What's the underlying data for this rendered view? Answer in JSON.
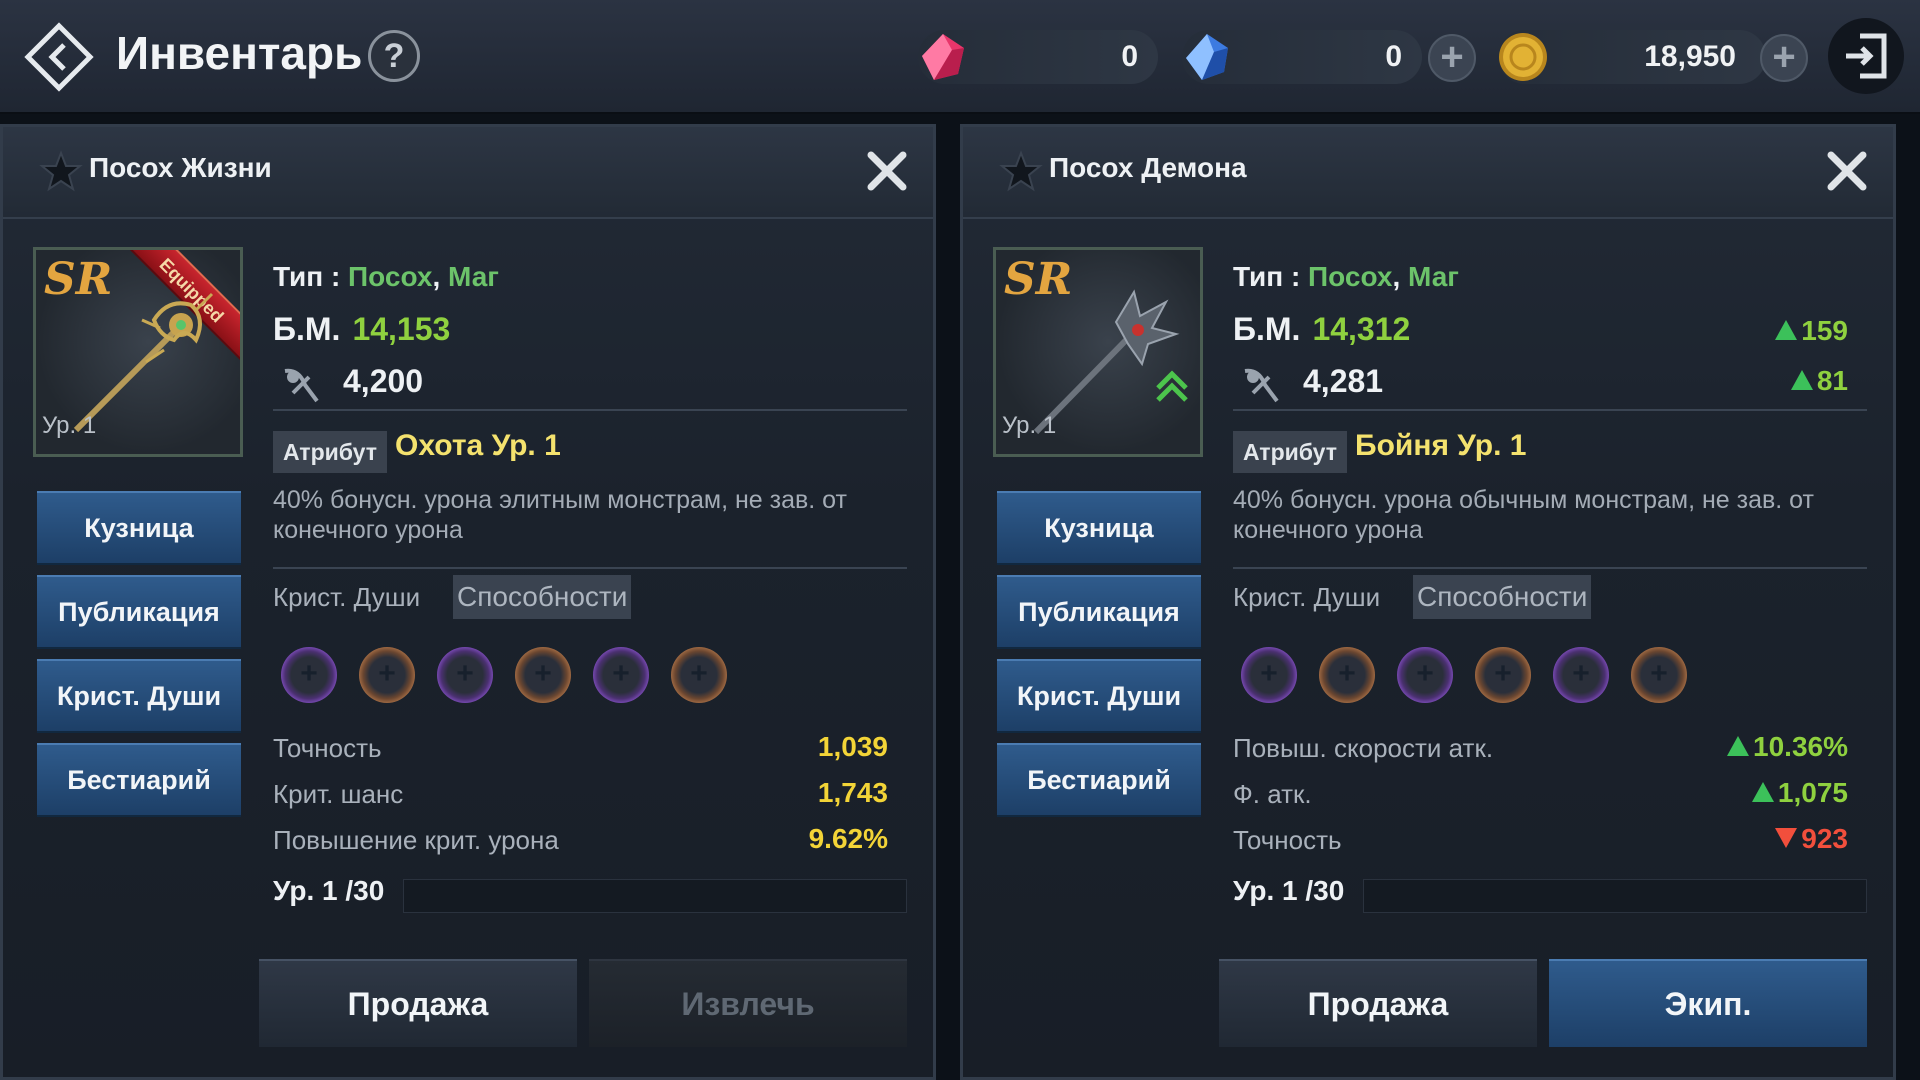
{
  "header": {
    "title": "Инвентарь",
    "help_label": "?",
    "currencies": [
      {
        "name": "red-gem",
        "value": "0",
        "color": "#e8366b"
      },
      {
        "name": "blue-gem",
        "value": "0",
        "color": "#3d7be0"
      },
      {
        "name": "gold",
        "value": "18,950",
        "color": "#e2b234"
      }
    ],
    "plus_label": "+"
  },
  "left": {
    "name": "Посох Жизни",
    "rank": "SR",
    "level": "Ур. 1",
    "equipped_label": "Equipped",
    "type_label": "Тип :",
    "type_value1": "Посох",
    "type_sep": ",",
    "type_value2": "Маг",
    "bm_label": "Б.М.",
    "bm_value": "14,153",
    "def_value": "4,200",
    "attr_tag": "Атрибут",
    "attr_name": "Охота Ур. 1",
    "desc": "40% бонусн. урона элитным монстрам, не зав. от конечного урона",
    "tab_soul": "Крист. Души",
    "tab_ability": "Способности",
    "stats": [
      {
        "name": "Точность",
        "value": "1,039"
      },
      {
        "name": "Крит. шанс",
        "value": "1,743"
      },
      {
        "name": "Повышение крит. урона",
        "value": "9.62%"
      }
    ],
    "exp_label": "Ур. 1  /30",
    "exp_fraction": 0,
    "side_buttons": [
      "Кузница",
      "Публикация",
      "Крист. Души",
      "Бестиарий"
    ],
    "sell_label": "Продажа",
    "extract_label": "Извлечь"
  },
  "right": {
    "name": "Посох Демона",
    "rank": "SR",
    "level": "Ур. 1",
    "type_label": "Тип :",
    "type_value1": "Посох",
    "type_sep": ",",
    "type_value2": "Маг",
    "bm_label": "Б.М.",
    "bm_value": "14,312",
    "bm_diff": "159",
    "def_value": "4,281",
    "def_diff": "81",
    "attr_tag": "Атрибут",
    "attr_name": "Бойня Ур. 1",
    "desc": "40% бонусн. урона обычным монстрам, не зав. от конечного урона",
    "tab_soul": "Крист. Души",
    "tab_ability": "Способности",
    "stats": [
      {
        "name": "Повыш. скорости атк.",
        "value": "10.36%",
        "trend": "up"
      },
      {
        "name": "Ф. атк.",
        "value": "1,075",
        "trend": "up"
      },
      {
        "name": "Точность",
        "value": "923",
        "trend": "down"
      }
    ],
    "exp_label": "Ур. 1  /30",
    "exp_fraction": 0,
    "side_buttons": [
      "Кузница",
      "Публикация",
      "Крист. Души",
      "Бестиарий"
    ],
    "sell_label": "Продажа",
    "equip_label": "Экип."
  }
}
